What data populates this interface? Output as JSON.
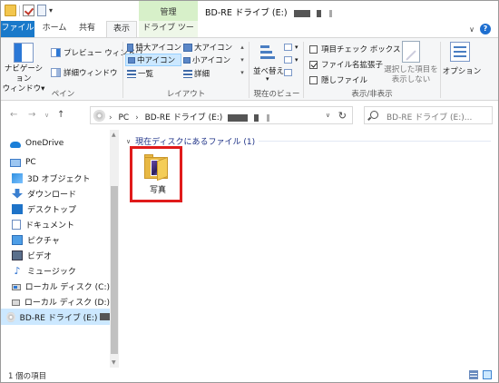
{
  "window": {
    "title": "BD-RE ドライブ (E:)",
    "tool_context": "管理"
  },
  "tabs": {
    "file": "ファイル",
    "home": "ホーム",
    "share": "共有",
    "view": "表示",
    "drive_tools": "ドライブ ツール"
  },
  "ribbon": {
    "pane": {
      "nav_pane": "ナビゲーション\nウィンドウ▾",
      "preview": "プレビュー ウィンドウ",
      "details": "詳細ウィンドウ",
      "label": "ペイン"
    },
    "layout": {
      "extra_large": "特大アイコン",
      "large": "大アイコン",
      "medium": "中アイコン",
      "small": "小アイコン",
      "list": "一覧",
      "details": "詳細",
      "label": "レイアウト"
    },
    "current_view": {
      "sort": "並べ替え",
      "label": "現在のビュー"
    },
    "show_hide": {
      "item_checkbox": "項目チェック ボックス",
      "extensions": "ファイル名拡張子",
      "hidden": "隠しファイル",
      "hide_selected": "選択した項目を\n表示しない",
      "label": "表示/非表示"
    },
    "options": "オプション"
  },
  "address": {
    "pc": "PC",
    "drive": "BD-RE ドライブ (E:)",
    "search_placeholder": "BD-RE ドライブ (E:)..."
  },
  "nav": {
    "items": [
      {
        "label": "OneDrive"
      },
      {
        "label": "PC"
      },
      {
        "label": "3D オブジェクト"
      },
      {
        "label": "ダウンロード"
      },
      {
        "label": "デスクトップ"
      },
      {
        "label": "ドキュメント"
      },
      {
        "label": "ピクチャ"
      },
      {
        "label": "ビデオ"
      },
      {
        "label": "ミュージック"
      },
      {
        "label": "ローカル ディスク (C:)"
      },
      {
        "label": "ローカル ディスク (D:)"
      },
      {
        "label": "BD-RE ドライブ (E:)"
      }
    ]
  },
  "content": {
    "group_header": "現在ディスクにあるファイル (1)",
    "files": [
      {
        "name": "写真",
        "icon": "photo-folder-icon"
      }
    ]
  },
  "status": {
    "item_count": "1 個の項目"
  },
  "colors": {
    "file_tab": "#1979ca",
    "manage_tab": "#d7f0c9",
    "selection": "#cce8ff",
    "highlight": "#e01b1b"
  }
}
